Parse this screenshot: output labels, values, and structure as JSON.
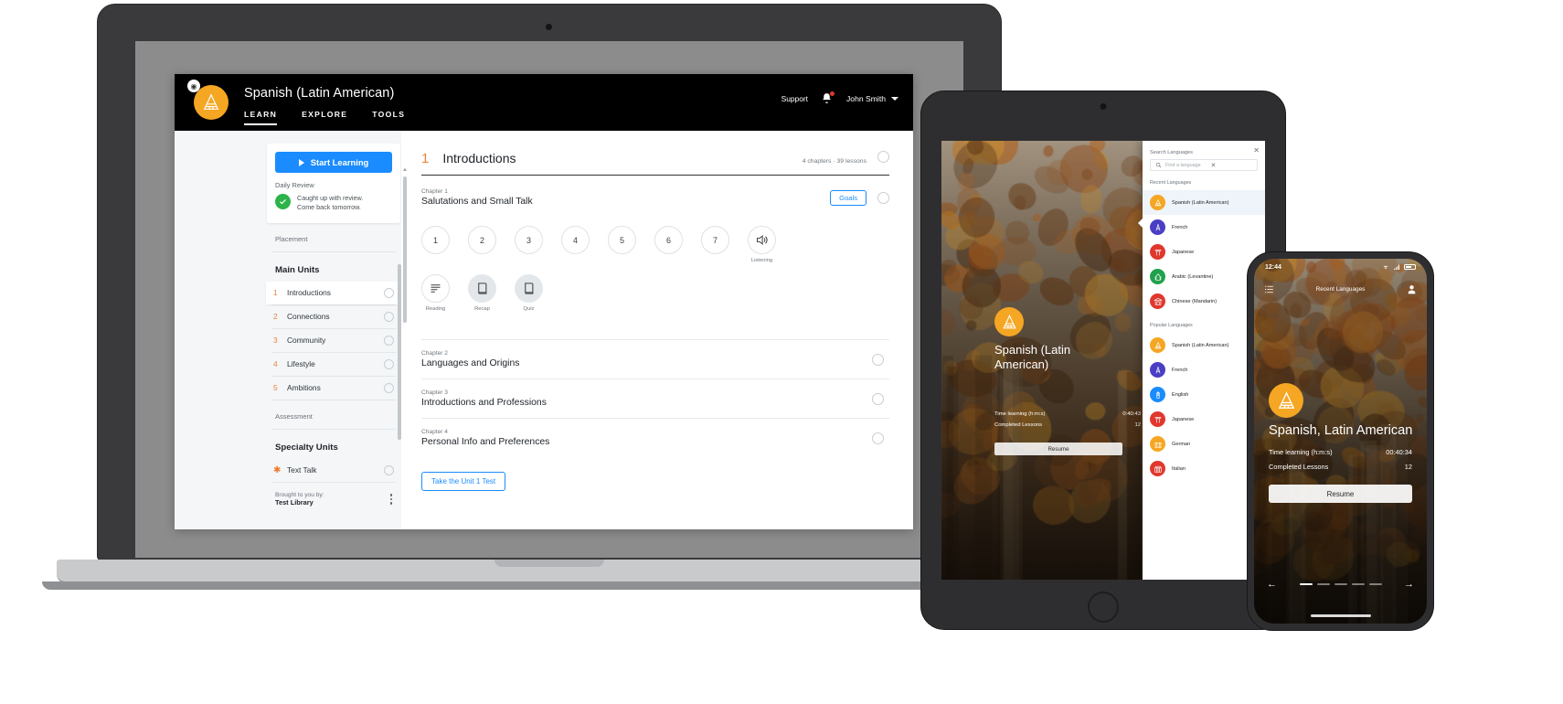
{
  "laptop": {
    "topbar": {
      "logo_icon": "pyramid-icon",
      "badge_icon": "globe-icon",
      "app_title": "Spanish (Latin American)",
      "nav": [
        {
          "label": "LEARN",
          "active": true
        },
        {
          "label": "EXPLORE",
          "active": false
        },
        {
          "label": "TOOLS",
          "active": false
        }
      ],
      "support_label": "Support",
      "bell_icon": "notification-bell-icon",
      "user_name": "John Smith",
      "caret_icon": "chevron-down-icon"
    },
    "sidebar": {
      "start_button": "Start Learning",
      "play_icon": "play-icon",
      "daily_review_label": "Daily Review",
      "check_icon": "check-circle-icon",
      "daily_review_line1": "Caught up with review.",
      "daily_review_line2": "Come back tomorrow.",
      "placement_label": "Placement",
      "main_units_heading": "Main Units",
      "main_units": [
        {
          "num": "1",
          "label": "Introductions"
        },
        {
          "num": "2",
          "label": "Connections"
        },
        {
          "num": "3",
          "label": "Community"
        },
        {
          "num": "4",
          "label": "Lifestyle"
        },
        {
          "num": "5",
          "label": "Ambitions"
        }
      ],
      "assessment_label": "Assessment",
      "specialty_heading": "Specialty Units",
      "specialty_units": [
        {
          "icon": "sparkle-icon",
          "label": "Text Talk"
        }
      ],
      "footer_line1": "Brought to you by:",
      "footer_line2": "Test Library",
      "kebab_icon": "more-vertical-icon"
    },
    "main": {
      "unit_number": "1",
      "unit_title": "Introductions",
      "unit_meta": "4 chapters · 39 lessons",
      "chapter1": {
        "label": "Chapter 1",
        "name": "Salutations and Small Talk",
        "goals_button": "Goals"
      },
      "lessons": [
        "1",
        "2",
        "3",
        "4",
        "5",
        "6",
        "7"
      ],
      "listening": {
        "icon": "speaker-wave-icon",
        "label": "Listening"
      },
      "activities": [
        {
          "icon": "reading-lines-icon",
          "label": "Reading",
          "filled": false
        },
        {
          "icon": "book-icon",
          "label": "Recap",
          "filled": true
        },
        {
          "icon": "book-icon",
          "label": "Quiz",
          "filled": true
        }
      ],
      "chapters": [
        {
          "label": "Chapter 2",
          "name": "Languages and Origins"
        },
        {
          "label": "Chapter 3",
          "name": "Introductions and Professions"
        },
        {
          "label": "Chapter 4",
          "name": "Personal Info and Preferences"
        }
      ],
      "unit_test_button": "Take the Unit 1 Test"
    }
  },
  "tablet": {
    "language_icon": "pyramid-icon",
    "language_name": "Spanish (Latin American)",
    "stats": [
      {
        "label": "Time learning (h:m:s)",
        "value": "0:40:43"
      },
      {
        "label": "Completed Lessons",
        "value": "12"
      }
    ],
    "resume_button": "Resume",
    "panel": {
      "title": "Search Languages",
      "close_icon": "close-icon",
      "search_icon": "search-icon",
      "search_placeholder": "Find a language",
      "search_clear_icon": "clear-icon",
      "recent_group": "Recent Languages",
      "recent": [
        {
          "name": "Spanish (Latin American)",
          "icon": "pyramid-icon",
          "color": "#f5a623",
          "selected": true
        },
        {
          "name": "French",
          "icon": "eiffel-tower-icon",
          "color": "#4a3fc4",
          "selected": false
        },
        {
          "name": "Japanese",
          "icon": "torii-gate-icon",
          "color": "#e0382d",
          "selected": false
        },
        {
          "name": "Arabic (Levantine)",
          "icon": "mosque-icon",
          "color": "#21a14b",
          "selected": false
        },
        {
          "name": "Chinese (Mandarin)",
          "icon": "temple-icon",
          "color": "#e0382d",
          "selected": false
        }
      ],
      "popular_group": "Popular Languages",
      "popular": [
        {
          "name": "Spanish (Latin American)",
          "icon": "pyramid-icon",
          "color": "#f5a623"
        },
        {
          "name": "French",
          "icon": "eiffel-tower-icon",
          "color": "#4a3fc4"
        },
        {
          "name": "English",
          "icon": "big-ben-icon",
          "color": "#1a8cff"
        },
        {
          "name": "Japanese",
          "icon": "torii-gate-icon",
          "color": "#e0382d"
        },
        {
          "name": "German",
          "icon": "brandenburg-gate-icon",
          "color": "#f5a623"
        },
        {
          "name": "Italian",
          "icon": "colosseum-icon",
          "color": "#e0382d"
        }
      ]
    }
  },
  "phone": {
    "status_time": "12:44",
    "wifi_icon": "wifi-icon",
    "signal_icon": "signal-icon",
    "battery_icon": "battery-icon",
    "menu_icon": "list-menu-icon",
    "nav_title": "Recent Languages",
    "profile_icon": "account-icon",
    "language_icon": "pyramid-icon",
    "language_name": "Spanish, Latin American",
    "stats": [
      {
        "label": "Time learning (h:m:s)",
        "value": "00:40:34"
      },
      {
        "label": "Completed Lessons",
        "value": "12"
      }
    ],
    "resume_button": "Resume",
    "prev_icon": "arrow-left-icon",
    "next_icon": "arrow-right-icon",
    "page_dots": 5,
    "active_dot": 0
  },
  "colors": {
    "accent_orange": "#f5a623",
    "accent_blue": "#1a8cff",
    "success_green": "#2cb34a",
    "topbar_black": "#000000"
  }
}
